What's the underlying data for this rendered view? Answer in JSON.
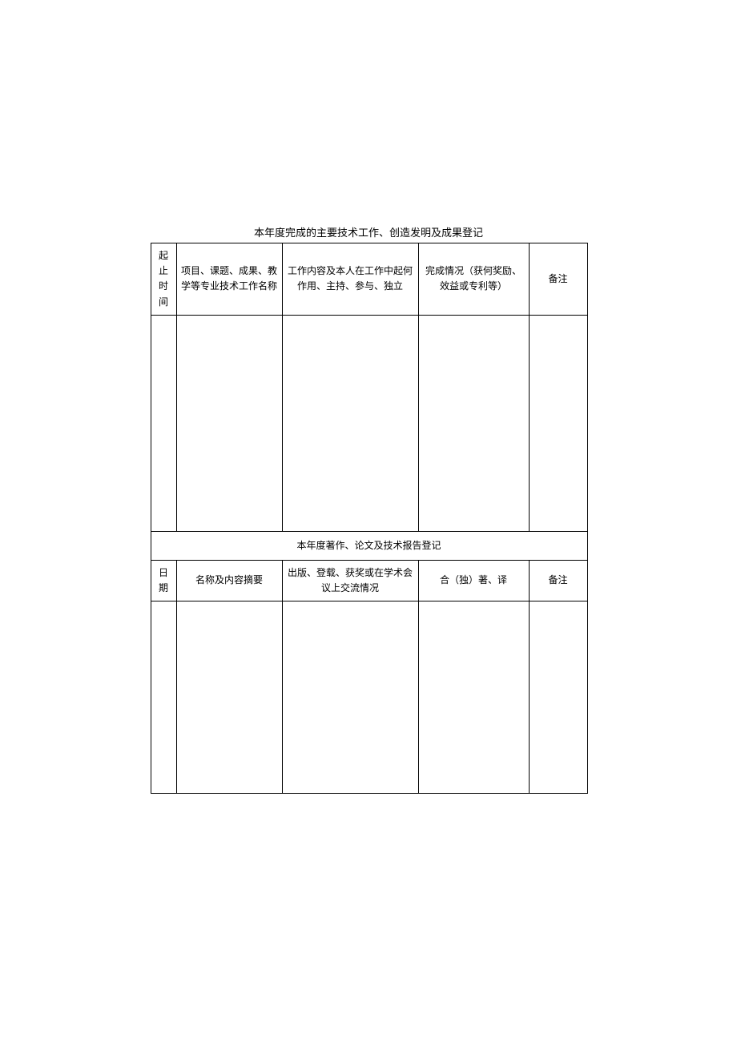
{
  "caption": "本年度完成的主要技术工作、创造发明及成果登记",
  "section1": {
    "headers": {
      "col1": "起止时间",
      "col2": "项目、课题、成果、教学等专业技术工作名称",
      "col3": "工作内容及本人在工作中起何作用、主持、参与、独立",
      "col4": "完成情况（获何奖励、效益或专利等）",
      "col5": "备注"
    },
    "row": {
      "col1": "",
      "col2": "",
      "col3": "",
      "col4": "",
      "col5": ""
    }
  },
  "section2": {
    "title": "本年度著作、论文及技术报告登记",
    "headers": {
      "col1": "日期",
      "col2": "名称及内容摘要",
      "col3": "出版、登载、获奖或在学术会议上交流情况",
      "col4": "合（独）著、译",
      "col5": "备注"
    },
    "row": {
      "col1": "",
      "col2": "",
      "col3": "",
      "col4": "",
      "col5": ""
    }
  }
}
